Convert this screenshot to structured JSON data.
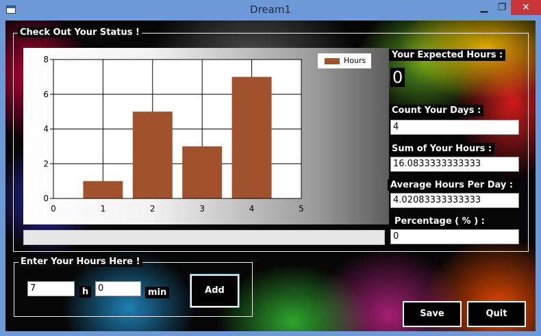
{
  "window": {
    "title": "Dream1",
    "min_glyph": "▁",
    "max_glyph": "❐",
    "close_glyph": "✕"
  },
  "status_group": {
    "label": "Check Out Your Status !"
  },
  "chart_data": {
    "type": "bar",
    "categories": [
      1,
      2,
      3,
      4
    ],
    "series": [
      {
        "name": "Hours",
        "values": [
          1,
          5,
          3,
          7
        ],
        "color": "#a0522d"
      }
    ],
    "x_ticks": [
      0,
      1,
      2,
      3,
      4,
      5
    ],
    "y_ticks": [
      0,
      2,
      4,
      6,
      8
    ],
    "xlim": [
      0,
      5
    ],
    "ylim": [
      0,
      8
    ],
    "grid": true,
    "legend": "top-right",
    "title": "",
    "xlabel": "",
    "ylabel": ""
  },
  "progress": {
    "value": 0
  },
  "expected": {
    "label": "Your Expected Hours :",
    "value": "0"
  },
  "days": {
    "label": "Count Your Days :",
    "value": "4"
  },
  "sum": {
    "label": "Sum of Your Hours :",
    "value": "16.0833333333333"
  },
  "average": {
    "label": "Average Hours Per Day :",
    "value": "4.02083333333333"
  },
  "percentage": {
    "label": "Percentage ( % ) :",
    "value": "0"
  },
  "entry_group": {
    "label": "Enter Your Hours Here !",
    "hours_value": "7",
    "hours_unit": "h",
    "minutes_value": "0",
    "minutes_unit": "min",
    "add_label": "Add"
  },
  "buttons": {
    "save_label": "Save",
    "quit_label": "Quit"
  }
}
